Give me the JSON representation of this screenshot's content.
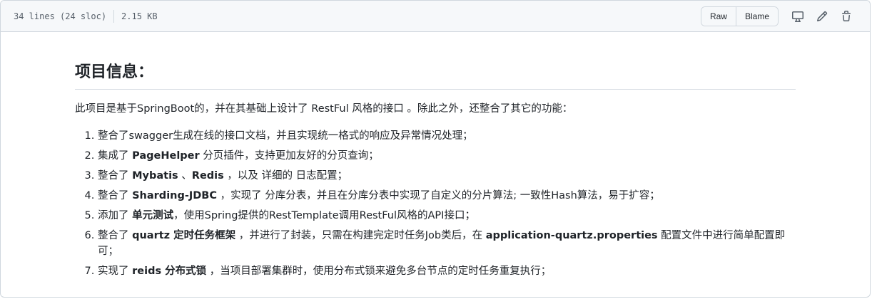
{
  "file_header": {
    "lines": "34 lines (24 sloc)",
    "size": "2.15 KB",
    "raw_label": "Raw",
    "blame_label": "Blame",
    "icons": [
      "desktop-icon",
      "pencil-icon",
      "trash-icon"
    ]
  },
  "readme": {
    "heading": "项目信息：",
    "intro": "此项目是基于SpringBoot的，并在其基础上设计了 RestFul 风格的接口 。除此之外，还整合了其它的功能：",
    "items": [
      {
        "a": "整合了swagger生成在线的接口文档，并且实现统一格式的响应及异常情况处理；"
      },
      {
        "a": "集成了 ",
        "b": "PageHelper",
        "c": " 分页插件，支持更加友好的分页查询；"
      },
      {
        "a": "整合了 ",
        "b": "Mybatis",
        "c": " 、",
        "d": "Redis",
        "e": " ，以及 详细的 日志配置；"
      },
      {
        "a": "整合了 ",
        "b": "Sharding-JDBC",
        "c": " ，实现了 分库分表，并且在分库分表中实现了自定义的分片算法; 一致性Hash算法，易于扩容；"
      },
      {
        "a": "添加了 ",
        "b": "单元测试",
        "c": "，使用Spring提供的RestTemplate调用RestFul风格的API接口；"
      },
      {
        "a": "整合了 ",
        "b": "quartz 定时任务框架",
        "c": " ，并进行了封装，只需在构建完定时任务Job类后，在 ",
        "d": "application-quartz.properties",
        "e": " 配置文件中进行简单配置即可；"
      },
      {
        "a": "实现了 ",
        "b": "reids 分布式锁",
        "c": " ，当项目部署集群时，使用分布式锁来避免多台节点的定时任务重复执行；"
      }
    ]
  }
}
